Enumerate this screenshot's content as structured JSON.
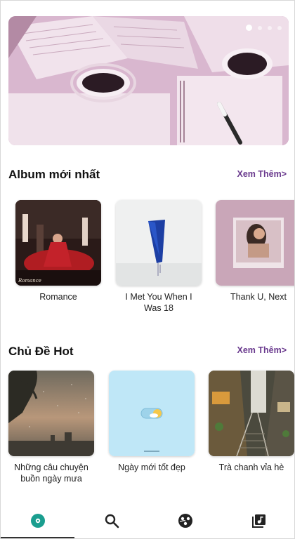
{
  "banner": {
    "slides": 4,
    "active_index": 0
  },
  "sections": {
    "albums": {
      "title": "Album mới nhất",
      "more": "Xem Thêm>",
      "items": [
        {
          "label": "Romance",
          "cover_text": "Romance"
        },
        {
          "label": "I Met You When I Was 18"
        },
        {
          "label": "Thank U, Next"
        }
      ]
    },
    "topics": {
      "title": "Chủ Đề Hot",
      "more": "Xem Thêm>",
      "items": [
        {
          "label": "Những câu chuyện buồn ngày mưa"
        },
        {
          "label": "Ngày mới tốt đẹp"
        },
        {
          "label": "Trà chanh vỉa hè"
        }
      ]
    }
  },
  "nav": {
    "items": [
      {
        "icon": "disc-icon",
        "color": "#1a9e8f"
      },
      {
        "icon": "search-icon",
        "color": "#222222"
      },
      {
        "icon": "genre-icon",
        "color": "#222222"
      },
      {
        "icon": "library-icon",
        "color": "#222222"
      }
    ],
    "active_index": 0
  },
  "colors": {
    "accent": "#6a3a8e",
    "active_nav": "#1a9e8f"
  }
}
